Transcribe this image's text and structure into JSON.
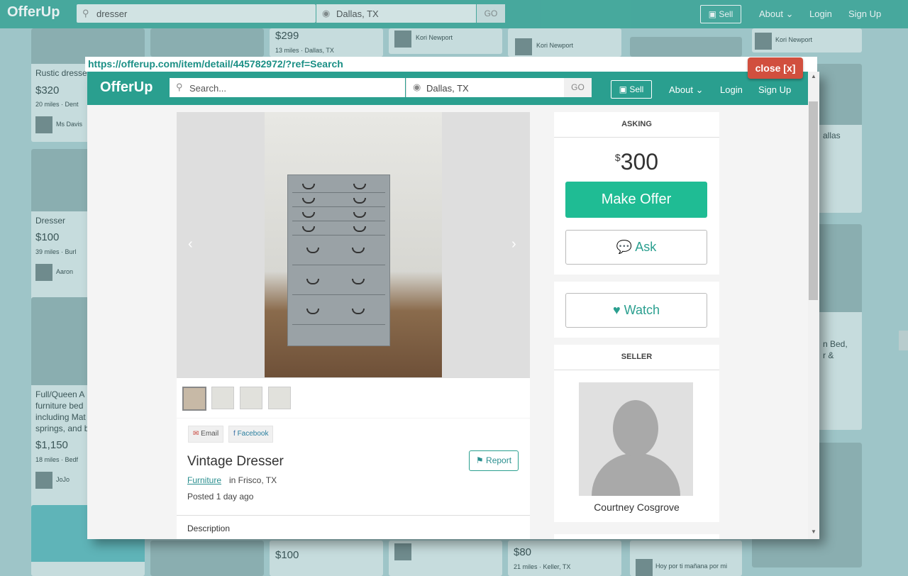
{
  "bg": {
    "logo": "OfferUp",
    "search_value": "dresser",
    "location_value": "Dallas, TX",
    "go_label": "GO",
    "sell_label": "Sell",
    "nav_about": "About",
    "nav_login": "Login",
    "nav_signup": "Sign Up",
    "cards": {
      "c1": {
        "title": "Rustic dresser",
        "price": "$320",
        "meta": "20 miles · Dent",
        "user": "Ms Davis"
      },
      "c2": {
        "title": "Dresser",
        "price": "$100",
        "meta": "39 miles · Burl",
        "user": "Aaron"
      },
      "c3": {
        "title_lines": [
          "Full/Queen A",
          "furniture bed",
          "including Mat",
          "springs, and b"
        ],
        "price": "$1,150",
        "meta": "18 miles · Bedf",
        "user": "JoJo"
      },
      "c4": {
        "price": "$299",
        "meta": "13 miles · Dallas, TX"
      },
      "c5": {
        "user": "Kori Newport"
      },
      "c6": {
        "user": "Kori Newport"
      },
      "c7": {
        "user": "Kori Newport"
      },
      "c8": {
        "price": "$100"
      },
      "c9": {
        "price": "$80",
        "meta": "21 miles · Keller, TX"
      },
      "c10": {
        "user": "Hoy por ti mañana por mi"
      },
      "r1": {
        "text": "allas"
      },
      "r2": {
        "text_lines": [
          "n Bed,",
          "r &"
        ]
      }
    }
  },
  "overlay": {
    "url": "https://offerup.com/item/detail/445782972/?ref=Search",
    "close_label": "close [x]"
  },
  "modal": {
    "logo": "OfferUp",
    "search_placeholder": "Search...",
    "location_value": "Dallas, TX",
    "go_label": "GO",
    "sell_label": "Sell",
    "nav_about": "About",
    "nav_login": "Login",
    "nav_signup": "Sign Up",
    "share_email": "Email",
    "share_facebook": "Facebook",
    "report_label": "Report",
    "item_title": "Vintage Dresser",
    "item_category": "Furniture",
    "item_location": "in Frisco, TX",
    "item_posted": "Posted 1 day ago",
    "description_label": "Description",
    "asking_header": "ASKING",
    "price_currency": "$",
    "price_value": "300",
    "make_offer_label": "Make Offer",
    "ask_label": "Ask",
    "watch_label": "Watch",
    "seller_header": "SELLER",
    "seller_name": "Courtney Cosgrove"
  },
  "colors": {
    "brand": "#2a9f8f",
    "make_offer": "#1fbc94",
    "close": "#d14f3e"
  },
  "icons": [
    "search-icon",
    "location-pin-icon",
    "camera-icon",
    "chevron-down-icon",
    "envelope-icon",
    "facebook-icon",
    "flag-icon",
    "chat-bubble-icon",
    "heart-icon",
    "chevron-left-icon",
    "chevron-right-icon"
  ]
}
